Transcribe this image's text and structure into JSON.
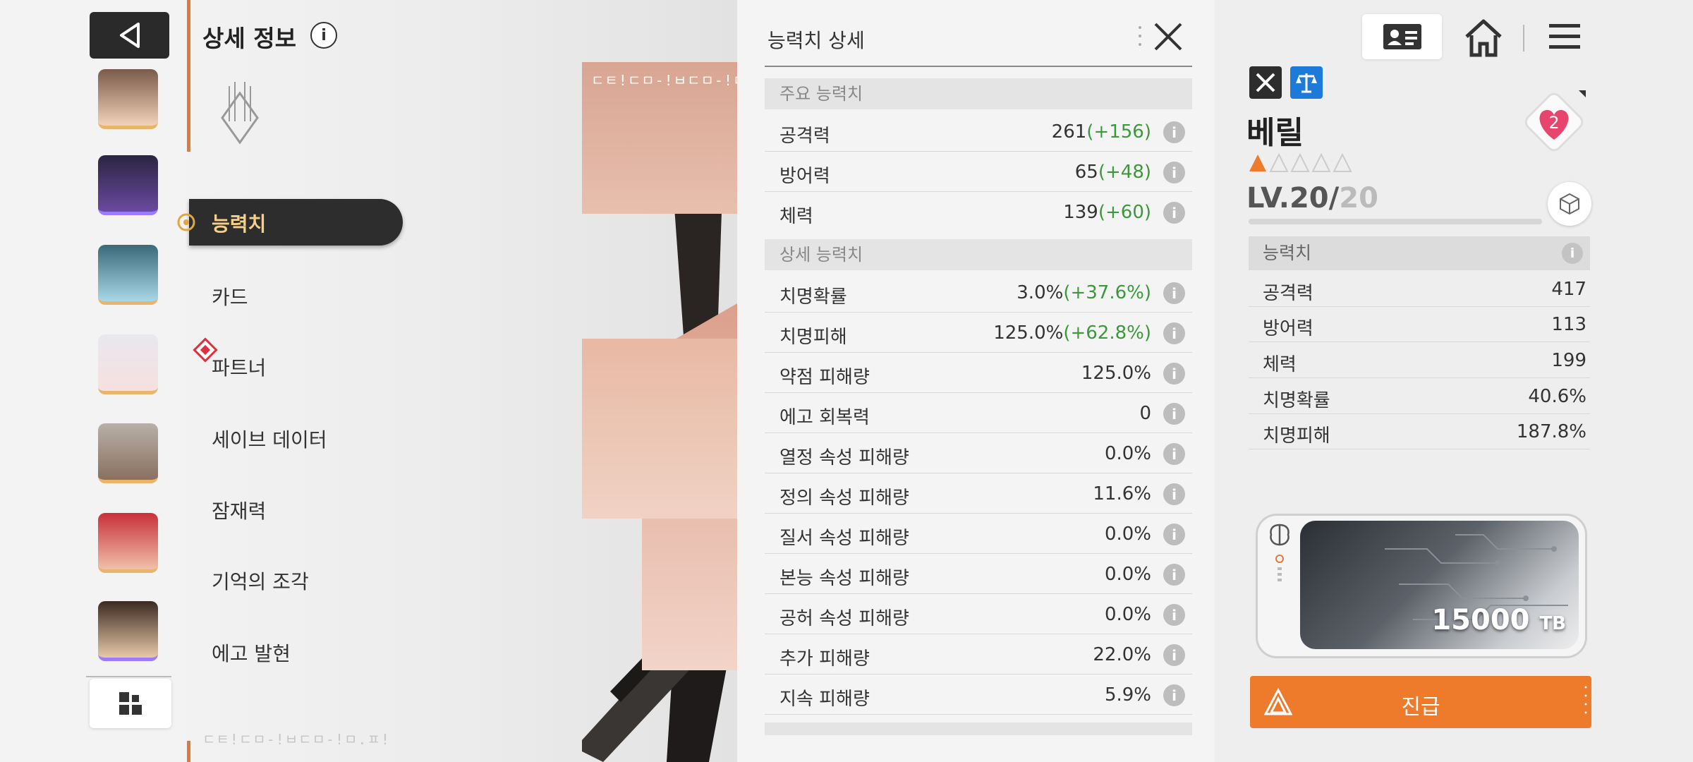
{
  "header": {
    "title": "상세 정보",
    "info_glyph": "i"
  },
  "nav": {
    "items": [
      "능력치",
      "카드",
      "파트너",
      "세이브 데이터",
      "잠재력",
      "기억의 조각",
      "에고 발현"
    ],
    "active_index": 0
  },
  "art_text": "ㄷㅌ!ㄷㅁ-!ㅂㄷㅁ-!ㅁ.ㅍ!",
  "stats_detail": {
    "title": "능력치 상세",
    "main_section": "주요 능력치",
    "main_rows": [
      {
        "label": "공격력",
        "value": "261",
        "bonus": "(+156)"
      },
      {
        "label": "방어력",
        "value": "65",
        "bonus": "(+48)"
      },
      {
        "label": "체력",
        "value": "139",
        "bonus": "(+60)"
      }
    ],
    "detail_section": "상세 능력치",
    "detail_rows": [
      {
        "label": "치명확률",
        "value": "3.0%",
        "bonus": "(+37.6%)"
      },
      {
        "label": "치명피해",
        "value": "125.0%",
        "bonus": "(+62.8%)"
      },
      {
        "label": "약점 피해량",
        "value": "125.0%",
        "bonus": ""
      },
      {
        "label": "에고 회복력",
        "value": "0",
        "bonus": ""
      },
      {
        "label": "열정 속성 피해량",
        "value": "0.0%",
        "bonus": ""
      },
      {
        "label": "정의 속성 피해량",
        "value": "11.6%",
        "bonus": ""
      },
      {
        "label": "질서 속성 피해량",
        "value": "0.0%",
        "bonus": ""
      },
      {
        "label": "본능 속성 피해량",
        "value": "0.0%",
        "bonus": ""
      },
      {
        "label": "공허 속성 피해량",
        "value": "0.0%",
        "bonus": ""
      },
      {
        "label": "추가 피해량",
        "value": "22.0%",
        "bonus": ""
      },
      {
        "label": "지속 피해량",
        "value": "5.9%",
        "bonus": ""
      }
    ],
    "info_glyph": "i"
  },
  "character": {
    "name": "베릴",
    "stars_filled": 1,
    "stars_total": 5,
    "level_current": "LV.20/",
    "level_max": "20",
    "level_progress": 1.0,
    "bond_level": "2",
    "stats_header": "능력치",
    "stats": [
      {
        "label": "공격력",
        "value": "417"
      },
      {
        "label": "방어력",
        "value": "113"
      },
      {
        "label": "체력",
        "value": "199"
      },
      {
        "label": "치명확률",
        "value": "40.6%"
      },
      {
        "label": "치명피해",
        "value": "187.8%"
      }
    ]
  },
  "memory_chip": {
    "value": "15000",
    "unit": "TB"
  },
  "advance_button": {
    "label": "진급"
  },
  "colors": {
    "accent_orange": "#ee7a2b",
    "bonus_green": "#3a9a3a",
    "nav_active_bg": "#2d2d2d",
    "nav_active_text": "#f5d08a",
    "heart_pink": "#e8456e"
  }
}
